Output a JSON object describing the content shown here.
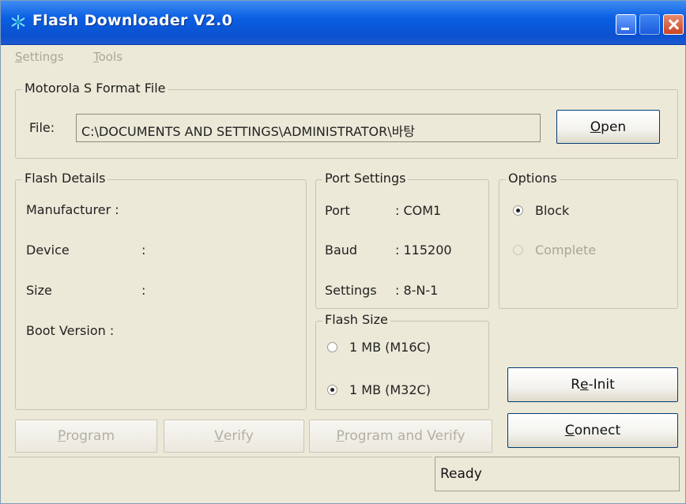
{
  "window": {
    "title": "Flash Downloader V2.0"
  },
  "menu": {
    "settings_prefix": "S",
    "settings_rest": "ettings",
    "tools_prefix": "T",
    "tools_rest": "ools"
  },
  "file_group": {
    "legend": "Motorola S Format File",
    "file_label": "File:",
    "file_path": "C:\\DOCUMENTS AND SETTINGS\\ADMINISTRATOR\\바탕",
    "open_prefix": "O",
    "open_rest": "pen"
  },
  "flash_details": {
    "legend": "Flash Details",
    "manufacturer": "Manufacturer :",
    "device": "Device",
    "size": "Size",
    "boot_version": "Boot Version :",
    "colon": ":"
  },
  "port_settings": {
    "legend": "Port Settings",
    "port_label": "Port",
    "port_value": ": COM1",
    "baud_label": "Baud",
    "baud_value": ": 115200",
    "settings_label": "Settings",
    "settings_value": ": 8-N-1"
  },
  "options": {
    "legend": "Options",
    "block": "Block",
    "block_checked": true,
    "complete": "Complete",
    "complete_enabled": false
  },
  "flash_size": {
    "legend": "Flash Size",
    "opt1": "1 MB (M16C)",
    "opt2": "1 MB (M32C)",
    "selected": "1 MB (M32C)"
  },
  "buttons": {
    "reinit_a": "R",
    "reinit_u": "e",
    "reinit_b": "-Init",
    "connect_u": "C",
    "connect_rest": "onnect",
    "program_u": "P",
    "program_rest": "rogram",
    "verify_u": "V",
    "verify_rest": "erify",
    "program_verify_u": "P",
    "program_verify_rest": "rogram and Verify"
  },
  "status": {
    "text": "Ready"
  },
  "colors": {
    "titlebar": "#0b51cf",
    "window_bg": "#ece9d8",
    "close_button": "#c84427"
  },
  "icons": [
    "app-snowflake-icon",
    "minimize-icon",
    "maximize-icon",
    "close-icon",
    "radio-icon"
  ]
}
